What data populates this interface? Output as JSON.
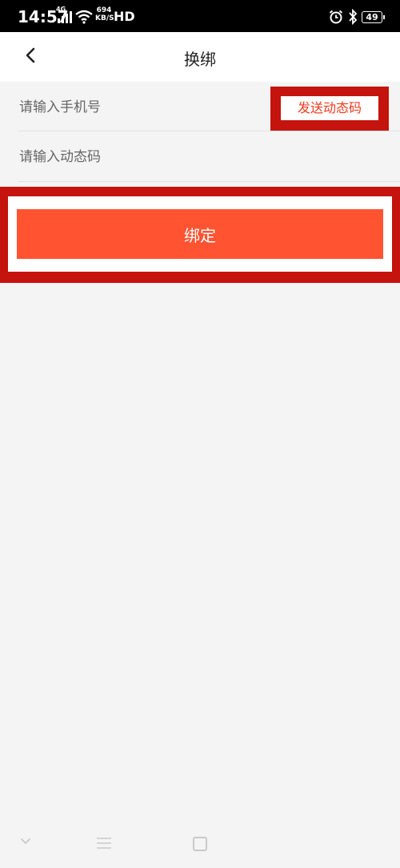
{
  "status_bar": {
    "time": "14:57",
    "network": "4G",
    "speed_value": "694",
    "speed_unit": "KB/S",
    "hd": "HD",
    "battery": "49"
  },
  "header": {
    "title": "换绑",
    "back_icon": "chevron-left-icon"
  },
  "form": {
    "phone_placeholder": "请输入手机号",
    "code_placeholder": "请输入动态码",
    "send_code_label": "发送动态码",
    "bind_label": "绑定"
  },
  "colors": {
    "accent": "#ff5331",
    "highlight_frame": "#c4140d",
    "send_code_text": "#f03a1e",
    "background": "#f4f4f4"
  },
  "nav_bar": {
    "icons": [
      "nav-back-icon",
      "nav-menu-icon",
      "nav-home-icon"
    ]
  }
}
